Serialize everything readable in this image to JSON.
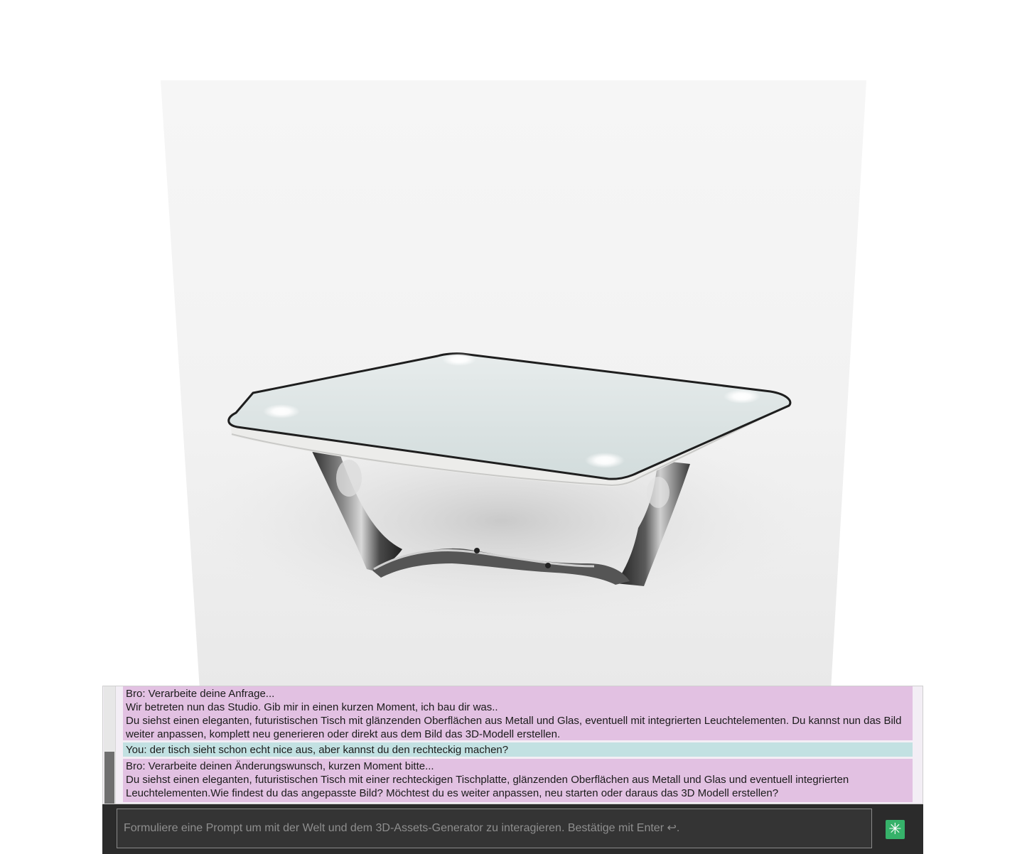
{
  "chat": {
    "messages": [
      {
        "role": "bot",
        "lines": [
          "Bro: Verarbeite deine Anfrage...",
          "Wir betreten nun das Studio. Gib mir in einen kurzen Moment, ich bau dir was..",
          "Du siehst einen eleganten, futuristischen Tisch mit glänzenden Oberflächen aus Metall und Glas, eventuell mit integrierten Leuchtelementen. Du kannst nun das Bild weiter anpassen, komplett neu generieren oder direkt aus dem Bild das 3D-Modell erstellen."
        ]
      },
      {
        "role": "you",
        "lines": [
          "You: der tisch sieht schon echt nice aus, aber kannst du den rechteckig machen?"
        ]
      },
      {
        "role": "bot",
        "lines": [
          "Bro: Verarbeite deinen Änderungswunsch, kurzen Moment bitte...",
          "Du siehst einen eleganten, futuristischen Tisch mit einer rechteckigen Tischplatte, glänzenden Oberflächen aus Metall und Glas und eventuell integrierten Leuchtelementen.Wie findest du das angepasste Bild? Möchtest du es weiter anpassen, neu starten oder daraus das 3D Modell erstellen?"
        ]
      }
    ]
  },
  "prompt": {
    "placeholder": "Formuliere eine Prompt um mit der Welt und dem 3D-Assets-Generator zu interagieren. Bestätige mit Enter ↩.",
    "value": "",
    "send_icon": "sparkle-icon",
    "send_glyph": "✳"
  },
  "colors": {
    "bot_bubble": "#e2c1e2",
    "you_bubble": "#c2e1e2",
    "prompt_bar": "#2b2b2b",
    "send_button": "#36b26a"
  }
}
